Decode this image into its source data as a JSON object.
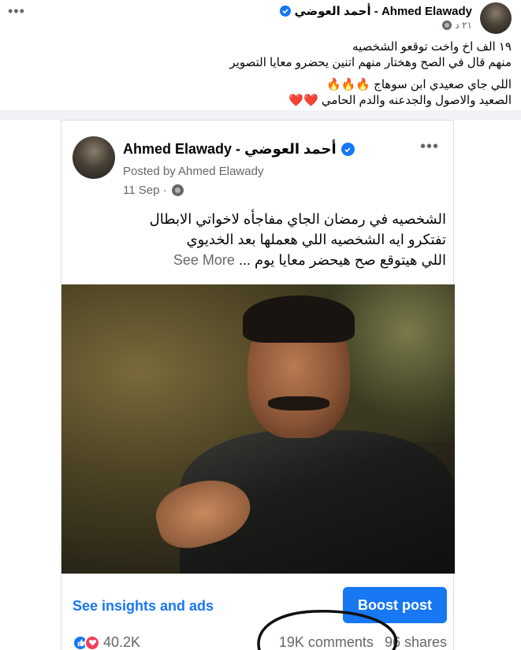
{
  "outer_post": {
    "author_name": "أحمد العوضي - Ahmed Elawady",
    "time": "٢١ د",
    "lines": [
      "١٩ الف اخ واخت توقعو الشخصيه",
      "منهم قال في الصح وهختار منهم اتنين يحضرو معايا  التصوير",
      "اللي جاي  صعيدي ابن سوهاج 🔥🔥🔥",
      "الصعيد  والاصول والجدعنه والدم الحامي ❤️❤️"
    ],
    "menu_label": "•••"
  },
  "shared_post": {
    "author_name": "Ahmed Elawady - أحمد العوضي",
    "posted_by": "Posted by Ahmed Elawady",
    "date": "11 Sep ·",
    "menu_label": "•••",
    "text_lines": [
      "الشخصيه في رمضان الجاي مفاجأه لاخواتي الابطال",
      "تفتكرو  ايه الشخصيه اللي هعملها بعد الخديوي",
      "اللي هيتوقع صح هيحضر معايا يوم ..."
    ],
    "see_more": "See More",
    "insights_link": "See insights and ads",
    "boost_button": "Boost post",
    "reactions_count": "40.2K",
    "comments": "19K comments",
    "shares": "96 shares"
  },
  "colors": {
    "accent": "#1877f2",
    "muted": "#65676b",
    "love": "#f33e58"
  }
}
